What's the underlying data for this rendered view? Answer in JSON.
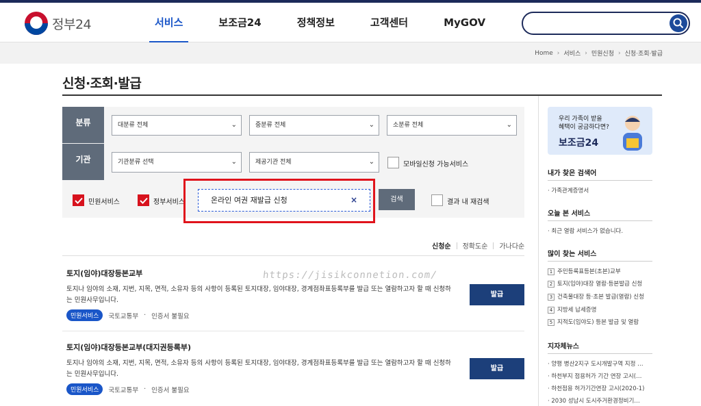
{
  "header": {
    "logo_text": "정부24",
    "nav": [
      "서비스",
      "보조금24",
      "정책정보",
      "고객센터",
      "MyGOV"
    ]
  },
  "breadcrumb": [
    "Home",
    "서비스",
    "민원신청",
    "신청·조회·발급"
  ],
  "page_title": "신청·조회·발급",
  "filter": {
    "category_label": "분류",
    "agency_label": "기관",
    "major": "대분류 전체",
    "middle": "중분류 전체",
    "minor": "소분류 전체",
    "agency_type": "기관분류 선택",
    "provider": "제공기관 전체",
    "mobile_label": "모바일신청 가능서비스",
    "civil_label": "민원서비스",
    "gov_label": "정부서비스",
    "query": "온라인 여권 재발급 신청",
    "clear": "×",
    "search_btn": "검색",
    "within_label": "결과 내 재검색"
  },
  "sort": [
    "신청순",
    "정확도순",
    "가나다순"
  ],
  "watermark": "https://jisikconnetion.com/",
  "results": [
    {
      "title": "토지(임야)대장등본교부",
      "desc": "토지나 임야의 소재, 지번, 지목, 면적, 소유자 등의 사항이 등록된 토지대장, 임야대장, 경계점좌표등록부를 발급 또는 열람하고자 할 때 신청하는 민원사무입니다.",
      "badge": "민원서비스",
      "agency": "국토교통부",
      "cert": "인증서 불필요",
      "button": "발급"
    },
    {
      "title": "토지(임야)대장등본교부(대지권등록부)",
      "desc": "토지나 임야의 소재, 지번, 지목, 면적, 소유자 등의 사항이 등록된 토지대장, 임야대장, 경계점좌표등록부를 발급 또는 열람하고자 할 때 신청하는 민원사무입니다.",
      "badge": "민원서비스",
      "agency": "국토교통부",
      "cert": "인증서 불필요",
      "button": "발급"
    }
  ],
  "aside": {
    "banner_l1": "우리 가족이 받을",
    "banner_l2": "혜택이 궁금하다면?",
    "banner_title": "보조금24",
    "recent_title": "내가 찾은 검색어",
    "recent_item": "· 가족관계증명서",
    "today_title": "오늘 본 서비스",
    "today_item": "· 최근 열람 서비스가 없습니다.",
    "popular_title": "많이 찾는 서비스",
    "popular": [
      "주민등록표등본(초본)교부",
      "토지(임야)대장 열람·등본발급 신청",
      "건축물대장 등·초본 발급(열람) 신청",
      "지방세 납세증명",
      "지적도(임야도) 등본 발급 및 열람"
    ],
    "news_title": "지자체뉴스",
    "news": [
      "· 양평 병산2지구 도시개발구역 지정 …",
      "· 하천부지 점용허가 기간 연장 고시(…",
      "· 하천점용 허가기간연장 고시(2020-1)",
      "· 2030 성남시 도시주거환경정비기…"
    ]
  }
}
